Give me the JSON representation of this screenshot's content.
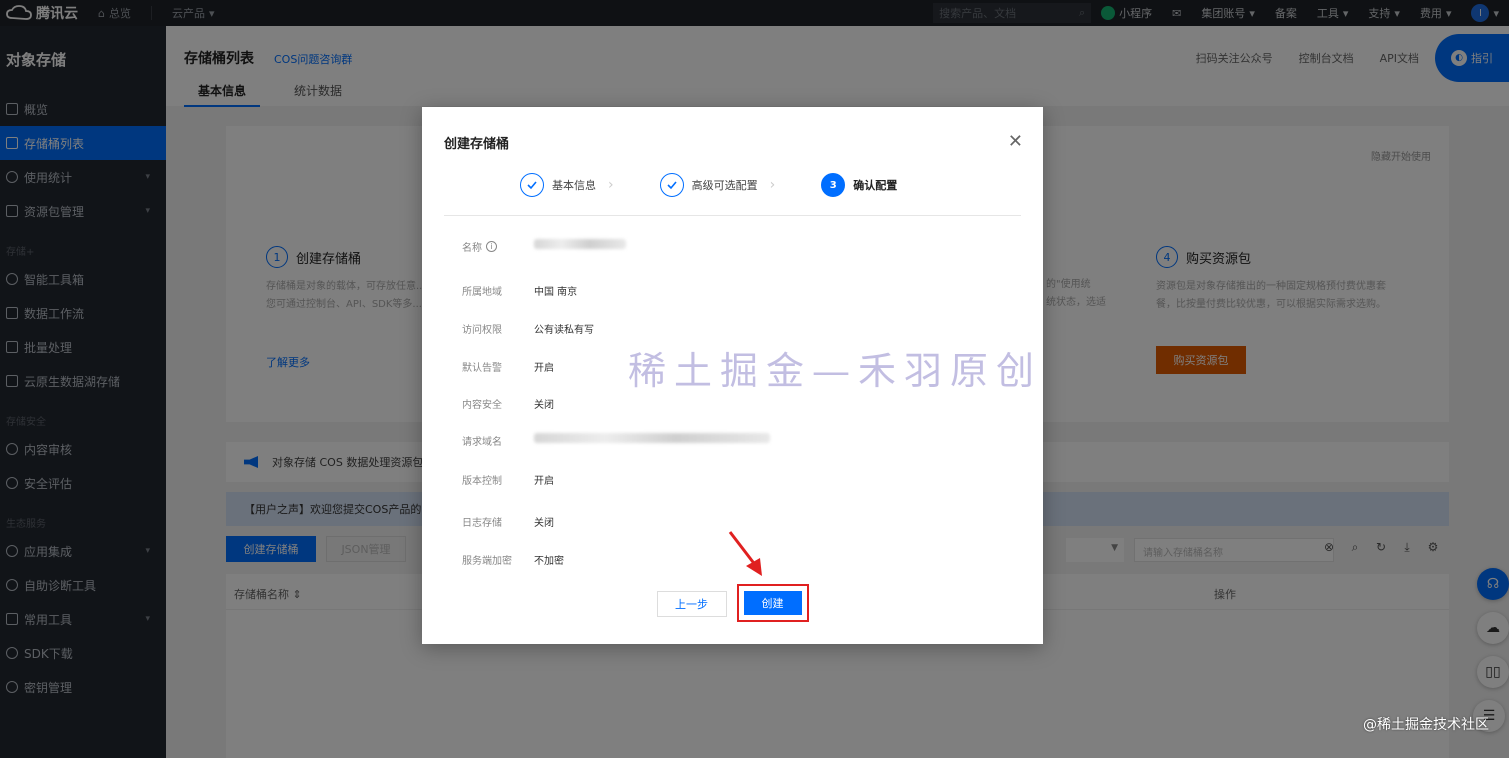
{
  "topbar": {
    "brand": "腾讯云",
    "home": "总览",
    "products": "云产品",
    "search_placeholder": "搜索产品、文档",
    "mini_program": "小程序",
    "account": "集团账号",
    "beian": "备案",
    "tools": "工具",
    "support": "支持",
    "billing": "费用",
    "avatar_initial": "I"
  },
  "sidebar": {
    "title": "对象存储",
    "items": [
      {
        "label": "概览"
      },
      {
        "label": "存储桶列表"
      },
      {
        "label": "使用统计"
      },
      {
        "label": "资源包管理"
      }
    ],
    "group_storage": "存储+",
    "storage_items": [
      {
        "label": "智能工具箱"
      },
      {
        "label": "数据工作流"
      },
      {
        "label": "批量处理"
      },
      {
        "label": "云原生数据湖存储"
      }
    ],
    "group_security": "存储安全",
    "security_items": [
      {
        "label": "内容审核"
      },
      {
        "label": "安全评估"
      }
    ],
    "group_eco": "生态服务",
    "eco_items": [
      {
        "label": "应用集成"
      },
      {
        "label": "自助诊断工具"
      },
      {
        "label": "常用工具"
      },
      {
        "label": "SDK下载"
      },
      {
        "label": "密钥管理"
      }
    ]
  },
  "page": {
    "title": "存储桶列表",
    "cos_group_link": "COS问题咨询群",
    "head_links": [
      "扫码关注公众号",
      "控制台文档",
      "API文档"
    ],
    "guide": "指引",
    "tabs": [
      "基本信息",
      "统计数据"
    ],
    "hide_link": "隐藏开始使用",
    "step1_title": "创建存储桶",
    "step1_desc": "存储桶是对象的载体，可存放任意...\n您可通过控制台、API、SDK等多...",
    "step4_title": "购买资源包",
    "step4_desc": "资源包是对象存储推出的一种固定规格预付费优惠套\n餐，比按量付费比较优惠，可以根据实际需求选购。",
    "partial_desc": "的\"使用统\n统状态，选适",
    "more_link": "了解更多",
    "buy_button": "购买资源包",
    "notice": "对象存储 COS 数据处理资源包...",
    "voice": "【用户之声】欢迎您提交COS产品的...",
    "create_bucket_btn": "创建存储桶",
    "json_btn": "JSON管理",
    "search_placeholder": "请输入存储桶名称",
    "col_name": "存储桶名称 ⇕",
    "col_ops": "操作"
  },
  "modal": {
    "title": "创建存储桶",
    "steps": [
      {
        "label": "基本信息",
        "status": "done"
      },
      {
        "label": "高级可选配置",
        "status": "done"
      },
      {
        "label": "确认配置",
        "status": "current",
        "number": "3"
      }
    ],
    "rows": [
      {
        "label": "名称",
        "value": "",
        "blurred": true
      },
      {
        "label": "所属地域",
        "value": "中国 南京"
      },
      {
        "label": "访问权限",
        "value": "公有读私有写"
      },
      {
        "label": "默认告警",
        "value": "开启"
      },
      {
        "label": "内容安全",
        "value": "关闭"
      },
      {
        "label": "请求域名",
        "value": "",
        "blurred": true
      },
      {
        "label": "版本控制",
        "value": "开启"
      },
      {
        "label": "日志存储",
        "value": "关闭"
      },
      {
        "label": "服务端加密",
        "value": "不加密"
      }
    ],
    "prev_button": "上一步",
    "create_button": "创建"
  },
  "watermark": "稀土掘金—禾羽原创",
  "footer_watermark": "@稀土掘金技术社区",
  "colors": {
    "primary": "#006eff",
    "highlight": "#e02020",
    "sidebar_bg": "#232830",
    "topbar_bg": "#1f2329"
  }
}
